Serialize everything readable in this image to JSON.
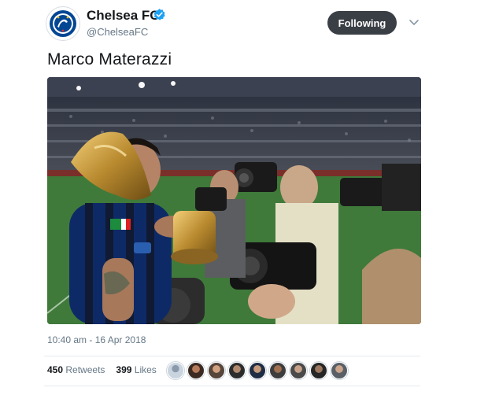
{
  "account": {
    "name": "Chelsea FC",
    "handle": "@ChelseaFC",
    "verified": true,
    "avatar_icon": "chelsea-crest-icon"
  },
  "actions": {
    "follow_label": "Following",
    "more_icon": "chevron-down-icon"
  },
  "tweet": {
    "text": "Marco Materazzi",
    "timestamp": "10:40 am - 16 Apr 2018"
  },
  "stats": {
    "retweets_count": "450",
    "retweets_label": "Retweets",
    "likes_count": "399",
    "likes_label": "Likes"
  },
  "likers": [
    {
      "icon": "user-avatar-icon"
    },
    {
      "icon": "user-avatar-icon"
    },
    {
      "icon": "user-avatar-icon"
    },
    {
      "icon": "user-avatar-icon"
    },
    {
      "icon": "user-avatar-icon"
    },
    {
      "icon": "user-avatar-icon"
    },
    {
      "icon": "user-avatar-icon"
    },
    {
      "icon": "user-avatar-icon"
    },
    {
      "icon": "user-avatar-icon"
    }
  ],
  "colors": {
    "brand_blue": "#034694",
    "verified_blue": "#1da1f2",
    "follow_button": "#3a3f45",
    "secondary_text": "#657786"
  }
}
